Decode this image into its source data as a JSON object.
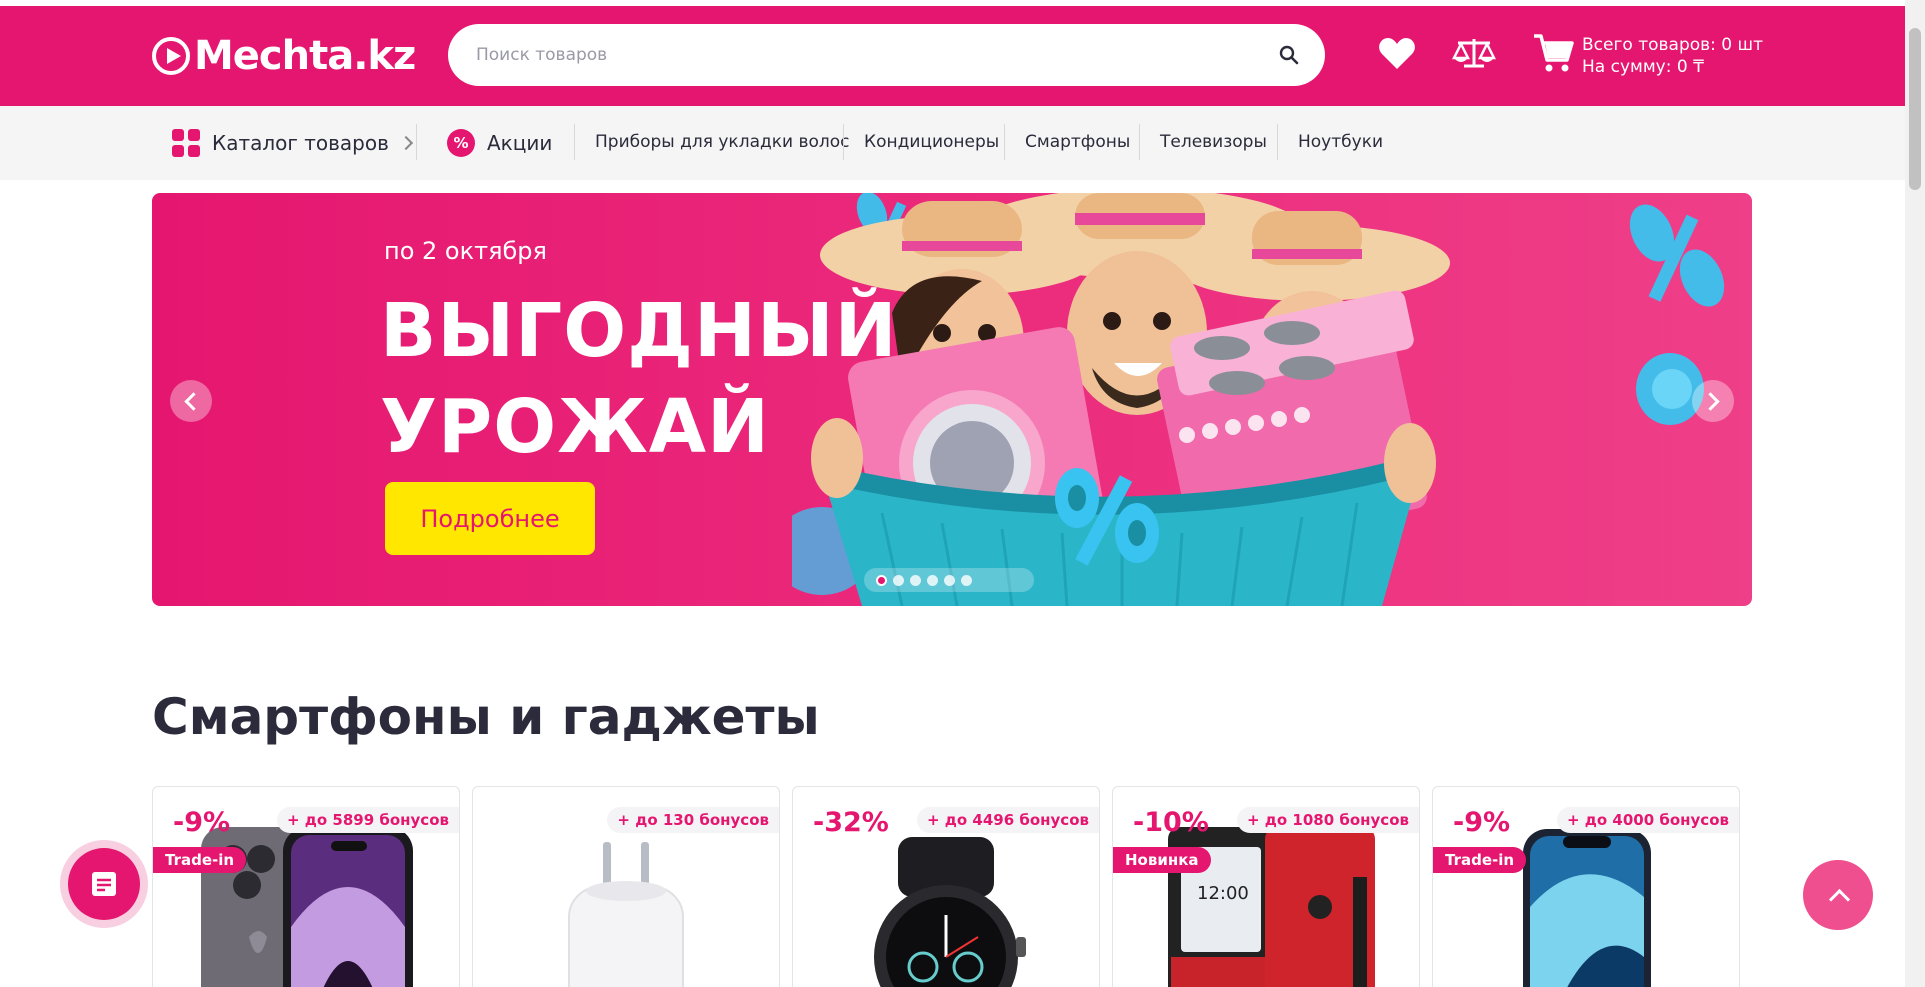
{
  "header": {
    "logo_text": "Mechta.kz",
    "search_placeholder": "Поиск товаров",
    "cart_count_text": "Всего товаров: 0 шт",
    "cart_sum_text": "На сумму: 0 ₸",
    "brand_color": "#e5166f"
  },
  "nav": {
    "catalog_label": "Каталог товаров",
    "promo_label": "Акции",
    "links": [
      "Приборы для укладки волос",
      "Кондиционеры",
      "Смартфоны",
      "Телевизоры",
      "Ноутбуки"
    ]
  },
  "banner": {
    "date": "по 2 октября",
    "title_line1": "ВЫГОДНЫЙ",
    "title_line2": "УРОЖАЙ",
    "cta_label": "Подробнее",
    "slides_count": 6,
    "active_slide": 1,
    "cta_color": "#ffe700"
  },
  "section": {
    "title": "Смартфоны и гаджеты"
  },
  "products": [
    {
      "discount": "-9%",
      "bonus": "+ до 5899 бонусов",
      "tag": "Trade-in",
      "image": "iphone-14-pro-purple"
    },
    {
      "discount": "",
      "bonus": "+ до 130 бонусов",
      "tag": "",
      "image": "white-charger-adapter"
    },
    {
      "discount": "-32%",
      "bonus": "+ до 4496 бонусов",
      "tag": "",
      "image": "black-smartwatch"
    },
    {
      "discount": "-10%",
      "bonus": "+ до 1080 бонусов",
      "tag": "Новинка",
      "image": "nokia-red-phone"
    },
    {
      "discount": "-9%",
      "bonus": "+ до 4000 бонусов",
      "tag": "Trade-in",
      "image": "iphone-13-blue"
    }
  ],
  "icons": {
    "search": "search-icon",
    "favorites": "heart-icon",
    "compare": "scales-icon",
    "cart": "cart-icon",
    "chat": "chat-icon",
    "scroll_up": "chevron-up-icon"
  }
}
